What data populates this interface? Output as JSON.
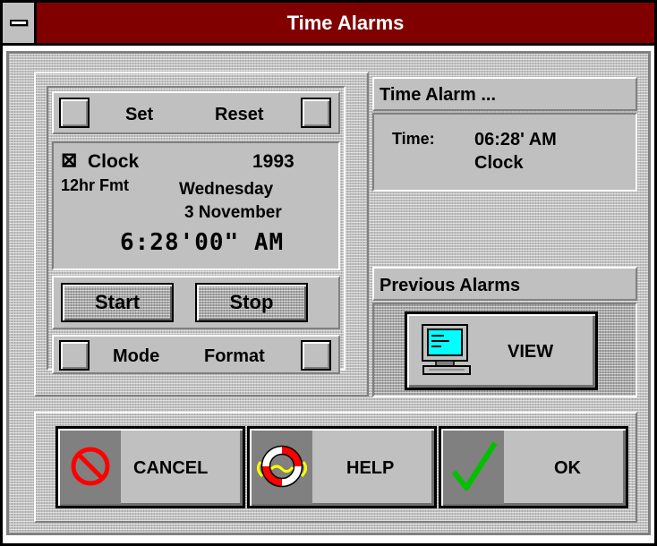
{
  "window": {
    "title": "Time Alarms"
  },
  "clock_panel": {
    "set_label": "Set",
    "reset_label": "Reset",
    "checkbox_glyph": "⊠",
    "clock_label": "Clock",
    "format_label": "12hr Fmt",
    "year": "1993",
    "weekday": "Wednesday",
    "date": "3 November",
    "time_display": "6:28'00\" AM",
    "start_label": "Start",
    "stop_label": "Stop",
    "mode_label": "Mode",
    "format_button_label": "Format"
  },
  "time_alarm": {
    "header": "Time Alarm ...",
    "time_caption": "Time:",
    "time_value": "06:28' AM",
    "name_value": "Clock"
  },
  "previous_alarms": {
    "header": "Previous Alarms",
    "view_label": "VIEW",
    "view_icon": "computer-icon"
  },
  "actions": {
    "cancel_label": "CANCEL",
    "cancel_icon": "no-entry-icon",
    "help_label": "HELP",
    "help_icon": "life-ring-icon",
    "ok_label": "OK",
    "ok_icon": "checkmark-icon"
  },
  "colors": {
    "titlebar": "#800000",
    "face": "#c0c0c0",
    "cancel_red": "#ff0000",
    "ok_green": "#00c000",
    "screen_cyan": "#00ffff"
  }
}
